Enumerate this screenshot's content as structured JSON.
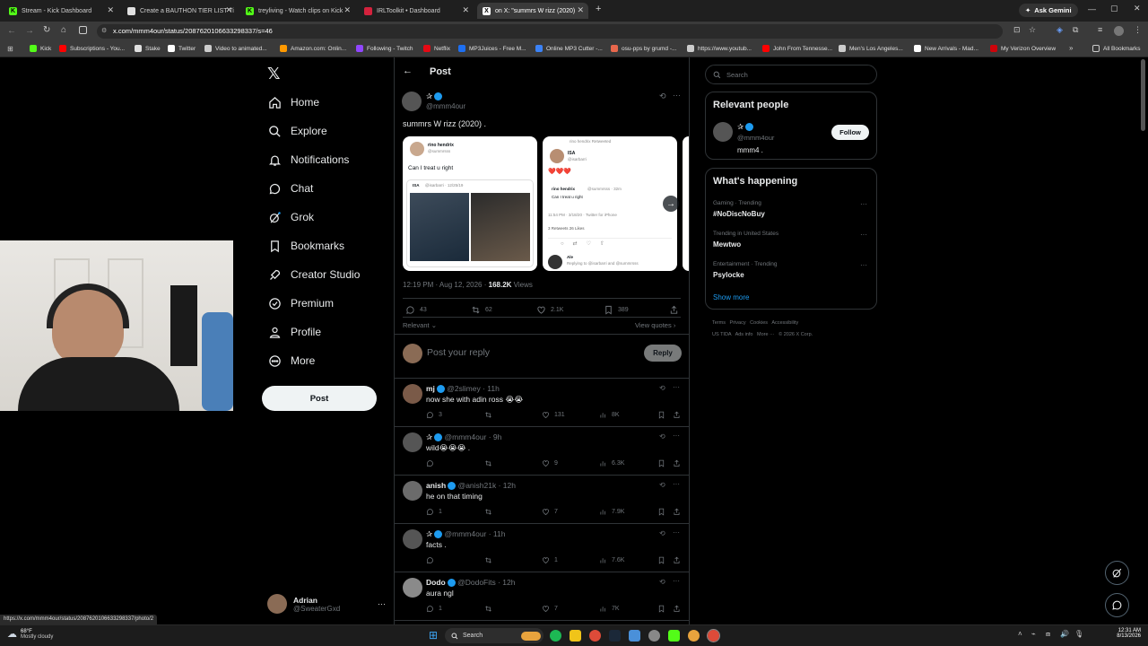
{
  "browser": {
    "tabs": [
      {
        "title": "Stream - Kick Dashboard",
        "color": "#53fc18",
        "glyph": "K"
      },
      {
        "title": "Create a BAUTHON TIER LIST Ti",
        "color": "#e0e0e0",
        "glyph": ""
      },
      {
        "title": "treyliving - Watch clips on Kick",
        "color": "#53fc18",
        "glyph": "K"
      },
      {
        "title": "IRLToolkit • Dashboard",
        "color": "#d4223d",
        "glyph": ""
      },
      {
        "title": "on X: \"summrs W rizz (2020)",
        "color": "#ffffff",
        "glyph": "X"
      }
    ],
    "ask_gemini": "Ask Gemini",
    "url": "x.com/mmm4our/status/2087620106633298337/s=46",
    "bookmarks": [
      "Kick",
      "Subscriptions - You...",
      "Stake",
      "Twitter",
      "Video to animated...",
      "Amazon.com: Onlin...",
      "Following - Twitch",
      "Netflix",
      "MP3Juices - Free M...",
      "Online MP3 Cutter -...",
      "osu-pps by grumd -...",
      "https://www.youtub...",
      "John From Tennesse...",
      "Men's Los Angeles...",
      "New Arrivals - Mad...",
      "My Verizon Overview"
    ],
    "all_bookmarks": "All Bookmarks",
    "status_url": "https://x.com/mmm4our/status/2087620106633298337/photo/2"
  },
  "nav": {
    "items": [
      "Home",
      "Explore",
      "Notifications",
      "Chat",
      "Grok",
      "Bookmarks",
      "Creator Studio",
      "Premium",
      "Profile",
      "More"
    ],
    "post_button": "Post",
    "account_name": "Adrian",
    "account_handle": "@SweaterGxd"
  },
  "post": {
    "header": "Post",
    "author_name": "✰",
    "author_handle": "@mmm4our",
    "text": "summrs W rizz (2020) .",
    "image1": {
      "name": "rino hendrix",
      "handle": "@summrsss",
      "text": "Can I treat u right",
      "quote_name": "ISA",
      "quote_handle": "@isarbarri · 12/25/19"
    },
    "image2": {
      "top": "rino hendrix Retweeted",
      "name": "ISA",
      "handle": "@isarbarri",
      "hearts": "❤️❤️❤️",
      "reply_name": "rino hendrix",
      "reply_handle": "@summrsss · 32m",
      "reply_text": "Can I treat u right",
      "meta": "11:54 PM · 3/18/20 · Twitter for iPhone",
      "stats": "3 Retweets  26 Likes",
      "bottom_name": "Ale",
      "bottom_text": "Replying to @isarbarri and @summrsss"
    },
    "timestamp": "12:19 PM · Aug 12, 2026 · ",
    "views": "168.2K",
    "views_label": "Views",
    "replies": "43",
    "reposts": "62",
    "likes": "2.1K",
    "bookmarks": "389",
    "sort": "Relevant",
    "view_quotes": "View quotes",
    "reply_placeholder": "Post your reply",
    "reply_button": "Reply"
  },
  "replies": [
    {
      "name": "mj",
      "handle": "@2slimey · 11h",
      "text": "now she with adin ross 😭😭",
      "replies": "3",
      "reposts": "",
      "likes": "131",
      "views": "8K"
    },
    {
      "name": "✰",
      "handle": "@mmm4our · 9h",
      "text": "wild😭😭😭 .",
      "replies": "",
      "reposts": "",
      "likes": "9",
      "views": "6.3K"
    },
    {
      "name": "anish",
      "handle": "@anish21k · 12h",
      "text": "he on that timing",
      "replies": "1",
      "reposts": "",
      "likes": "7",
      "views": "7.9K"
    },
    {
      "name": "✰",
      "handle": "@mmm4our · 11h",
      "text": "facts .",
      "replies": "",
      "reposts": "",
      "likes": "1",
      "views": "7.6K"
    },
    {
      "name": "Dodo",
      "handle": "@DodoFits · 12h",
      "text": "aura ngl",
      "replies": "1",
      "reposts": "",
      "likes": "7",
      "views": "7K"
    }
  ],
  "right": {
    "search_placeholder": "Search",
    "relevant_title": "Relevant people",
    "person_name": "✰",
    "person_handle": "@mmm4our",
    "person_bio": "mmm4 .",
    "follow": "Follow",
    "happening_title": "What's happening",
    "trends": [
      {
        "context": "Gaming · Trending",
        "name": "#NoDiscNoBuy"
      },
      {
        "context": "Trending in United States",
        "name": "Mewtwo"
      },
      {
        "context": "Entertainment · Trending",
        "name": "Psylocke"
      }
    ],
    "show_more": "Show more",
    "footer_line1": "Terms   Privacy   Cookies   Accessibility",
    "footer_line2": "US TIDA   Ads info   More ···   © 2026 X Corp."
  },
  "taskbar": {
    "weather_temp": "68°F",
    "weather_desc": "Mostly cloudy",
    "search": "Search",
    "time": "12:31 AM",
    "date": "8/13/2026"
  }
}
